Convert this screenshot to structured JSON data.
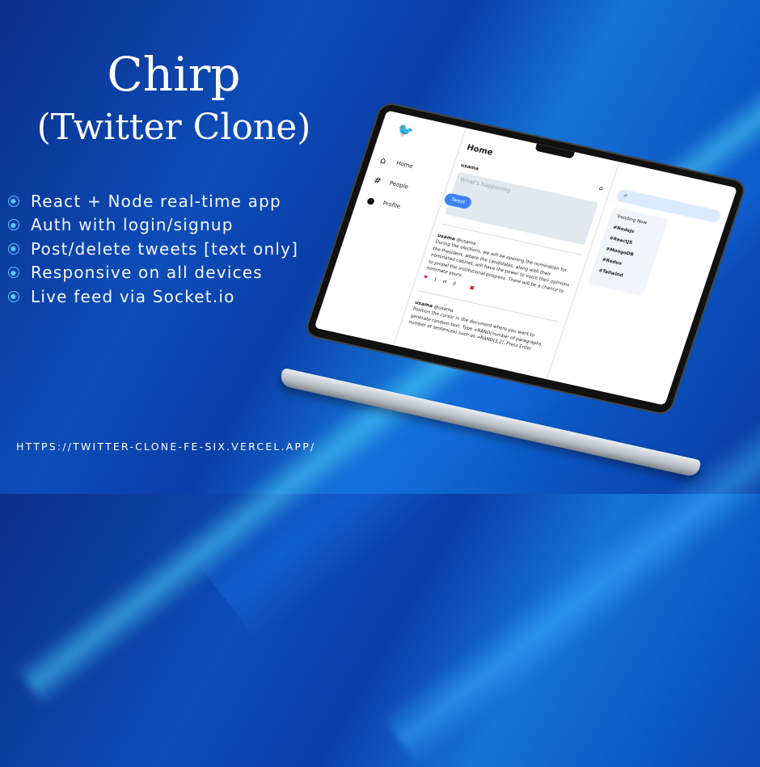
{
  "title_line1": "Chirp",
  "title_line2": "(Twitter Clone)",
  "features": [
    "React + Node real-time app",
    "Auth with login/signup",
    "Post/delete tweets [text only]",
    "Responsive on all devices",
    "Live feed via Socket.io"
  ],
  "url": "HTTPS://TWITTER-CLONE-FE-SIX.VERCEL.APP/",
  "app": {
    "nav": [
      "Home",
      "People",
      "Profile"
    ],
    "heading": "Home",
    "user": "usama",
    "placeholder": "What's happening",
    "tweet_button": "Tweet",
    "posts": [
      {
        "name": "usama",
        "handle": "@usama",
        "text": "During the elections, we will be opening the nomination for the President, where the candidates, along with their nominated cabinet, will have the power to voice their opinions to propel the institutional progress. There will be a chance to nominate yours",
        "likes": "1",
        "retweets": "0"
      },
      {
        "name": "usama",
        "handle": "@usama",
        "text": "Position the cursor in the document where you want to generate random text. Type =RAND(number of paragraphs, number of sentences) such as =RAND(3,2). Press Enter"
      }
    ],
    "trending_title": "Trending Now",
    "trends": [
      "#NodeJs",
      "#ReactJS",
      "#MongoDB",
      "#Redux",
      "#Tailwind"
    ]
  }
}
